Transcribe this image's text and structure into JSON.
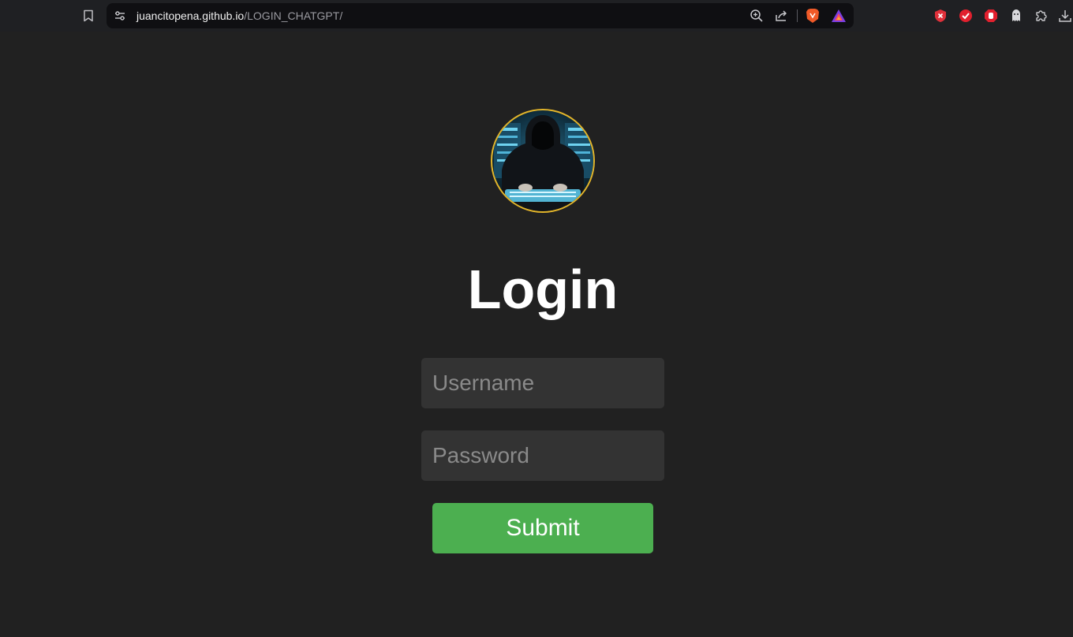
{
  "browser": {
    "url_host": "juancitopena.github.io",
    "url_path": "/LOGIN_CHATGPT/",
    "icons": [
      "bookmark-icon",
      "site-settings-icon",
      "zoom-icon",
      "share-icon",
      "brave-shields-icon",
      "brave-rewards-icon"
    ],
    "extension_icons": [
      "shield-x-extension-icon",
      "check-extension-icon",
      "stop-hand-extension-icon",
      "ghost-extension-icon",
      "extensions-puzzle-icon",
      "download-icon"
    ]
  },
  "page": {
    "avatar_alt": "hooded-hacker-avatar",
    "title": "Login",
    "username_placeholder": "Username",
    "password_placeholder": "Password",
    "submit_label": "Submit"
  },
  "colors": {
    "background": "#212121",
    "input_bg": "#333333",
    "submit_bg": "#4caf50",
    "avatar_ring": "#e3b52a"
  }
}
